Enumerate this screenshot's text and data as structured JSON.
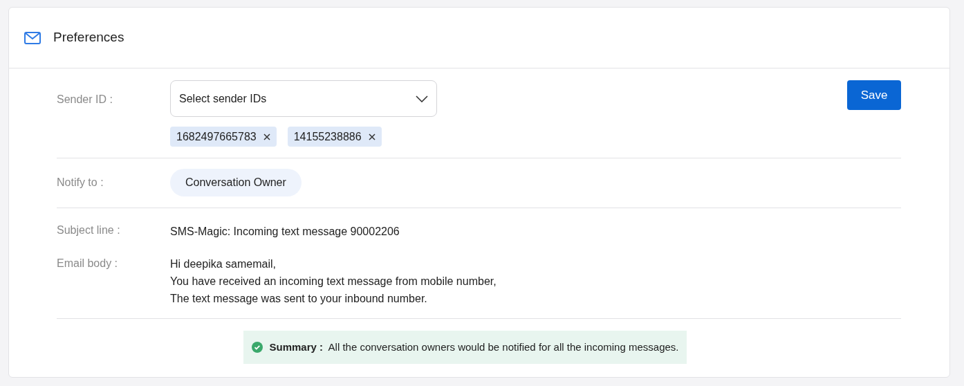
{
  "header": {
    "title": "Preferences"
  },
  "sender_id": {
    "label": "Sender ID :",
    "placeholder": "Select sender IDs",
    "tags": [
      "1682497665783",
      "14155238886"
    ]
  },
  "save_button": "Save",
  "notify_to": {
    "label": "Notify to :",
    "value": "Conversation Owner"
  },
  "subject_line": {
    "label": "Subject line :",
    "value": "SMS-Magic: Incoming text message 90002206"
  },
  "email_body": {
    "label": "Email body :",
    "lines": [
      "Hi deepika samemail,",
      "You have received an incoming text message from mobile number,",
      "The text message was sent to your inbound number."
    ]
  },
  "summary": "**Summary :**  All the conversation owners would be notified for all the incoming messages."
}
